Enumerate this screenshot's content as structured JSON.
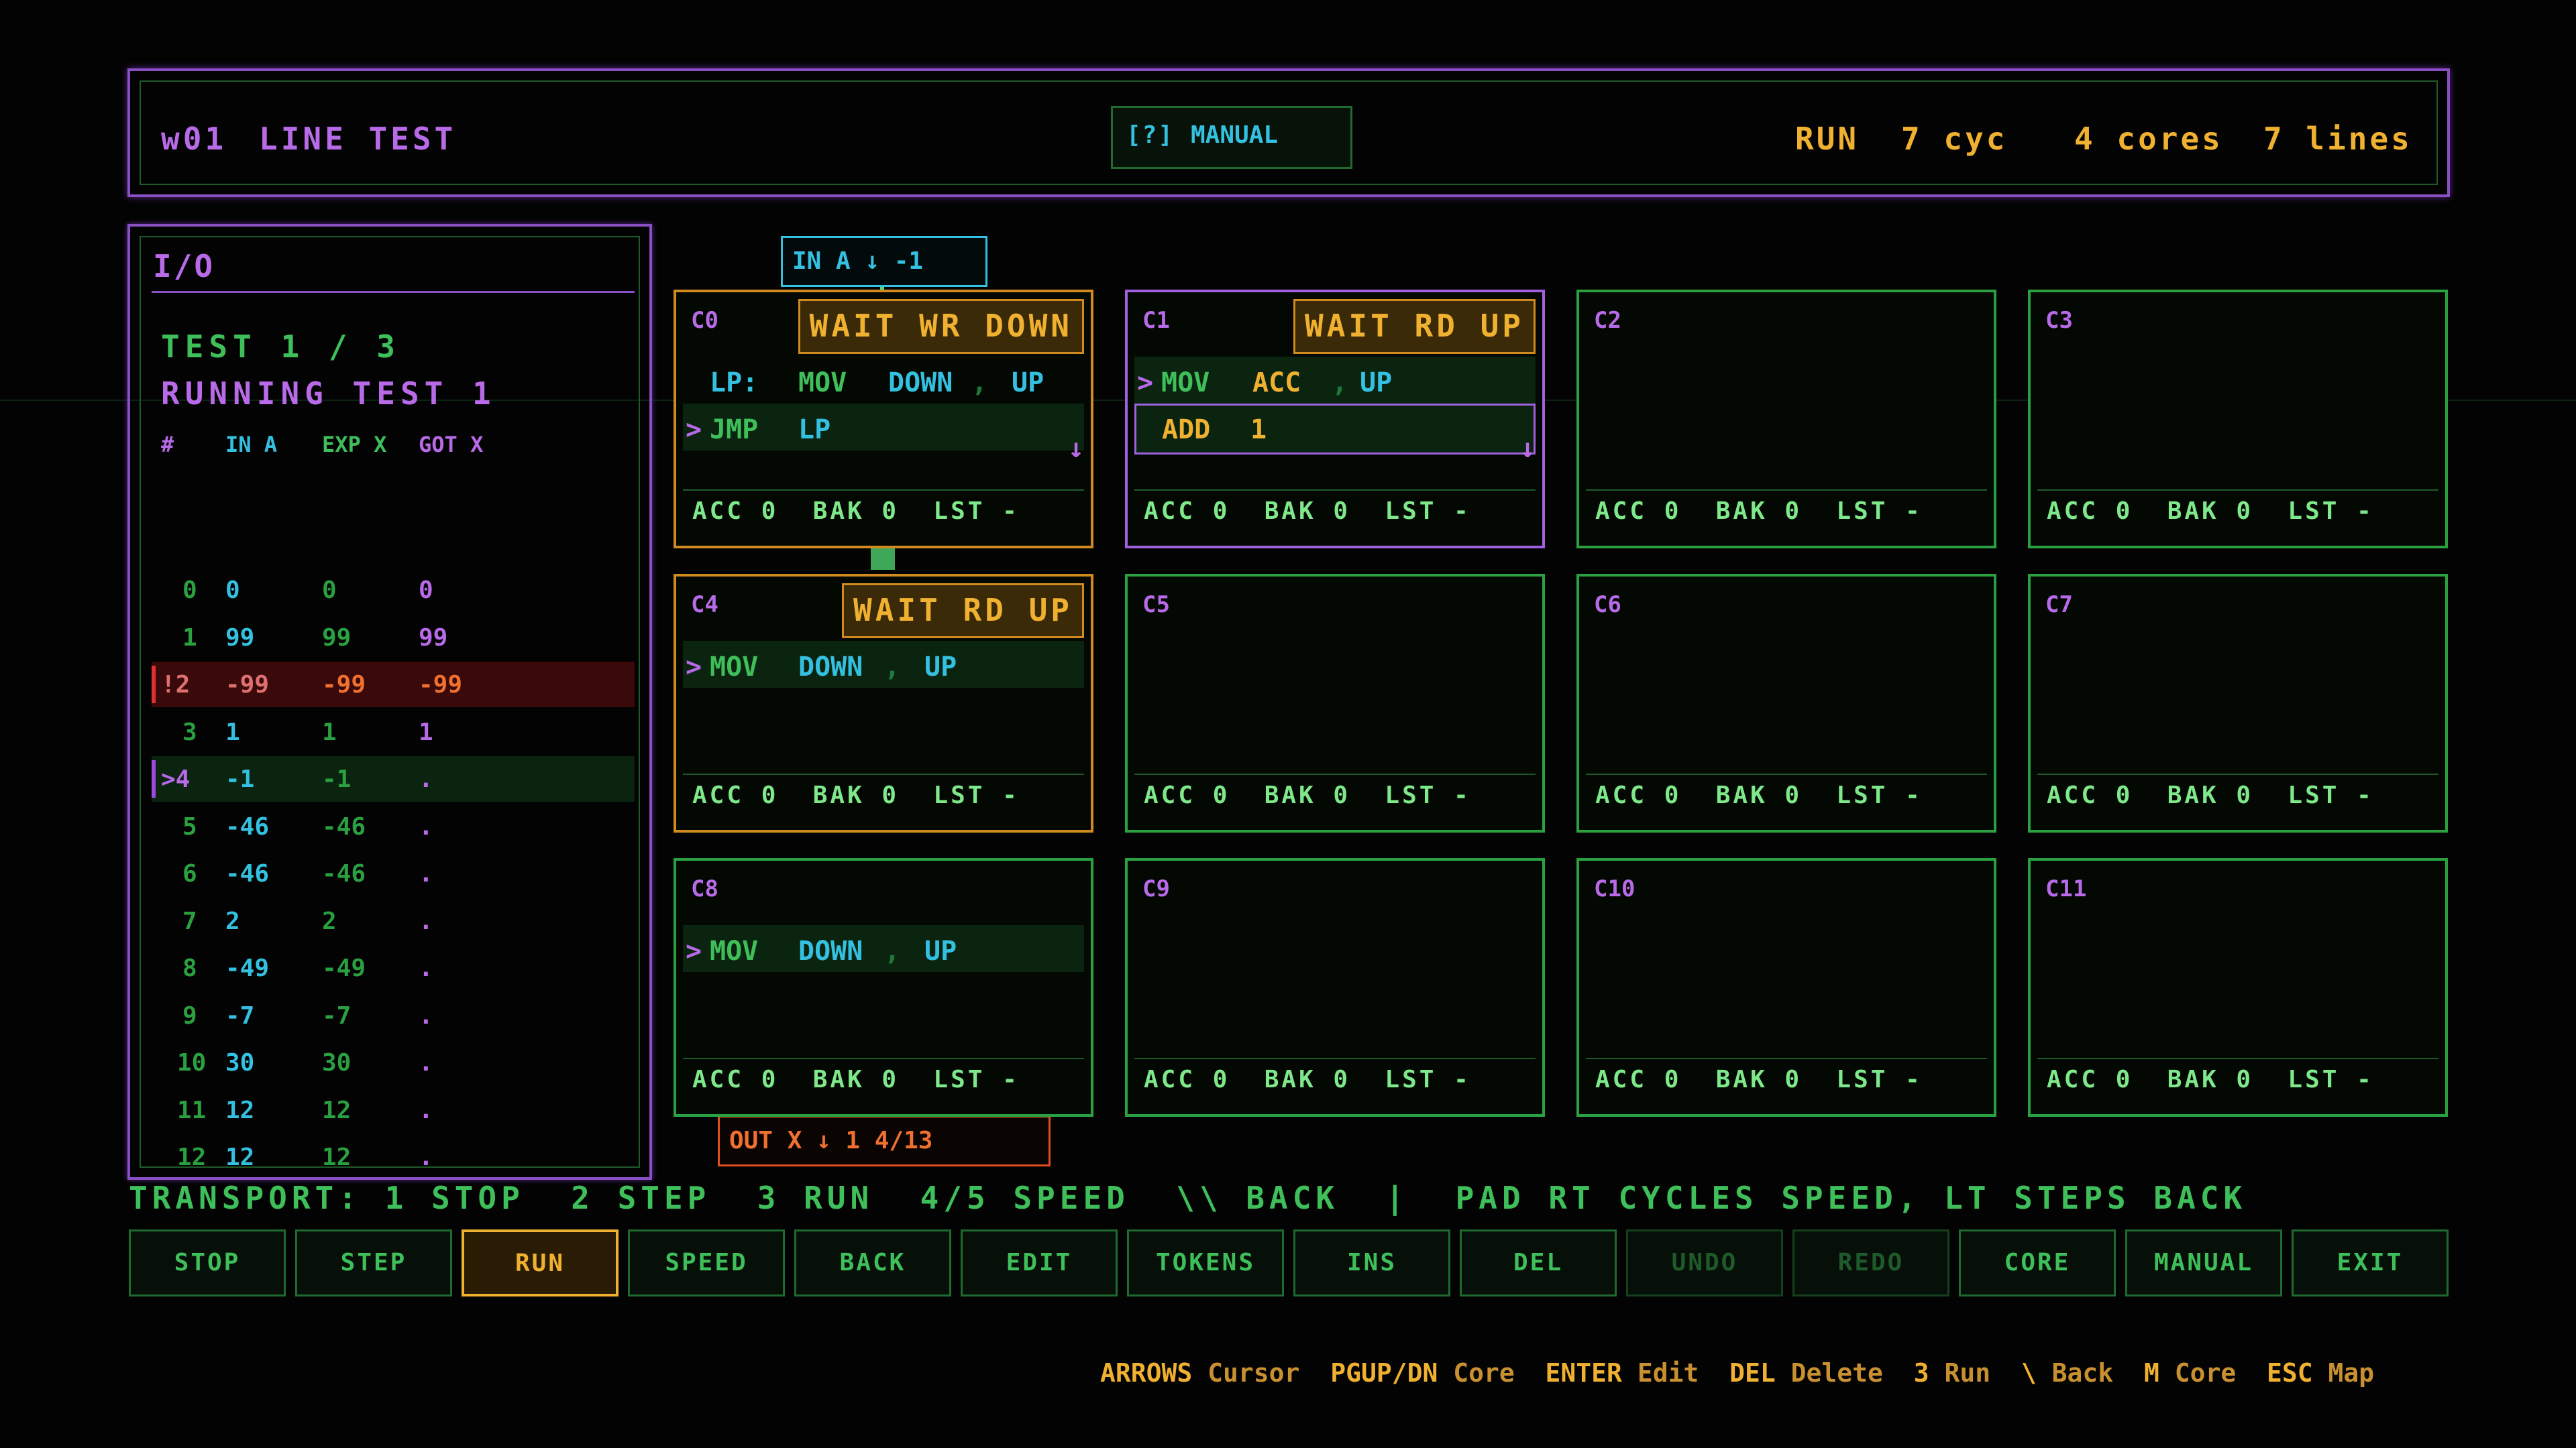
{
  "header": {
    "level_id": "w01",
    "level_name": "LINE TEST",
    "manual_key": "[?]",
    "manual_label": "MANUAL",
    "mode": "RUN",
    "cycles": "7 cyc",
    "cores": "4 cores",
    "lines": "7 lines"
  },
  "io": {
    "title": "I/O",
    "test": "TEST 1 / 3",
    "status": "RUNNING TEST 1",
    "columns": [
      "#",
      "IN A",
      "EXP X",
      "GOT X"
    ],
    "rows": [
      {
        "n": "0",
        "in": "0",
        "exp": "0",
        "got": "0"
      },
      {
        "n": "1",
        "in": "99",
        "exp": "99",
        "got": "99"
      },
      {
        "n": "!2",
        "in": "-99",
        "exp": "-99",
        "got": "-99"
      },
      {
        "n": "3",
        "in": "1",
        "exp": "1",
        "got": "1"
      },
      {
        "n": ">4",
        "in": "-1",
        "exp": "-1",
        "got": "."
      },
      {
        "n": "5",
        "in": "-46",
        "exp": "-46",
        "got": "."
      },
      {
        "n": "6",
        "in": "-46",
        "exp": "-46",
        "got": "."
      },
      {
        "n": "7",
        "in": "2",
        "exp": "2",
        "got": "."
      },
      {
        "n": "8",
        "in": "-49",
        "exp": "-49",
        "got": "."
      },
      {
        "n": "9",
        "in": "-7",
        "exp": "-7",
        "got": "."
      },
      {
        "n": "10",
        "in": "30",
        "exp": "30",
        "got": "."
      },
      {
        "n": "11",
        "in": "12",
        "exp": "12",
        "got": "."
      },
      {
        "n": "12",
        "in": "12",
        "exp": "12",
        "got": "."
      }
    ]
  },
  "in_badge": "IN A ↓ -1",
  "out_badge": "OUT X ↓ 1  4/13",
  "cores": {
    "c0": {
      "id": "C0",
      "status": "WAIT WR DOWN",
      "l1_label": "LP:",
      "l1_op": "MOV",
      "l1_a": "DOWN",
      "l1_sep": ",",
      "l1_b": "UP",
      "l2_op": "JMP",
      "l2_a": "LP",
      "regs": "ACC 0  BAK 0  LST -"
    },
    "c1": {
      "id": "C1",
      "status": "WAIT RD UP",
      "l1_op": "MOV",
      "l1_a": "ACC",
      "l1_sep": ",",
      "l1_b": "UP",
      "l2_op": "ADD",
      "l2_a": "1",
      "regs": "ACC 0  BAK 0  LST -"
    },
    "c2": {
      "id": "C2",
      "regs": "ACC 0  BAK 0  LST -"
    },
    "c3": {
      "id": "C3",
      "regs": "ACC 0  BAK 0  LST -"
    },
    "c4": {
      "id": "C4",
      "status": "WAIT RD UP",
      "l1_op": "MOV",
      "l1_a": "DOWN",
      "l1_sep": ",",
      "l1_b": "UP",
      "regs": "ACC 0  BAK 0  LST -"
    },
    "c5": {
      "id": "C5",
      "regs": "ACC 0  BAK 0  LST -"
    },
    "c6": {
      "id": "C6",
      "regs": "ACC 0  BAK 0  LST -"
    },
    "c7": {
      "id": "C7",
      "regs": "ACC 0  BAK 0  LST -"
    },
    "c8": {
      "id": "C8",
      "l1_op": "MOV",
      "l1_a": "DOWN",
      "l1_sep": ",",
      "l1_b": "UP",
      "regs": "ACC 0  BAK 0  LST -"
    },
    "c9": {
      "id": "C9",
      "regs": "ACC 0  BAK 0  LST -"
    },
    "c10": {
      "id": "C10",
      "regs": "ACC 0  BAK 0  LST -"
    },
    "c11": {
      "id": "C11",
      "regs": "ACC 0  BAK 0  LST -"
    }
  },
  "transport": "TRANSPORT: 1 STOP  2 STEP  3 RUN  4/5 SPEED  \\\\ BACK  |  PAD RT CYCLES SPEED, LT STEPS BACK",
  "buttons": [
    "STOP",
    "STEP",
    "RUN",
    "SPEED",
    "BACK",
    "EDIT",
    "TOKENS",
    "INS",
    "DEL",
    "UNDO",
    "REDO",
    "CORE",
    "MANUAL",
    "EXIT"
  ],
  "hints": [
    {
      "k": "ARROWS",
      "d": "Cursor"
    },
    {
      "k": "PGUP/DN",
      "d": "Core"
    },
    {
      "k": "ENTER",
      "d": "Edit"
    },
    {
      "k": "DEL",
      "d": "Delete"
    },
    {
      "k": "3",
      "d": "Run"
    },
    {
      "k": "\\",
      "d": "Back"
    },
    {
      "k": "M",
      "d": "Core"
    },
    {
      "k": "ESC",
      "d": "Map"
    }
  ],
  "colors": {
    "green": "#3fbf5a",
    "purple": "#b86ae8",
    "orange": "#f0b030",
    "cyan": "#34c0e0",
    "red": "#e03030"
  }
}
